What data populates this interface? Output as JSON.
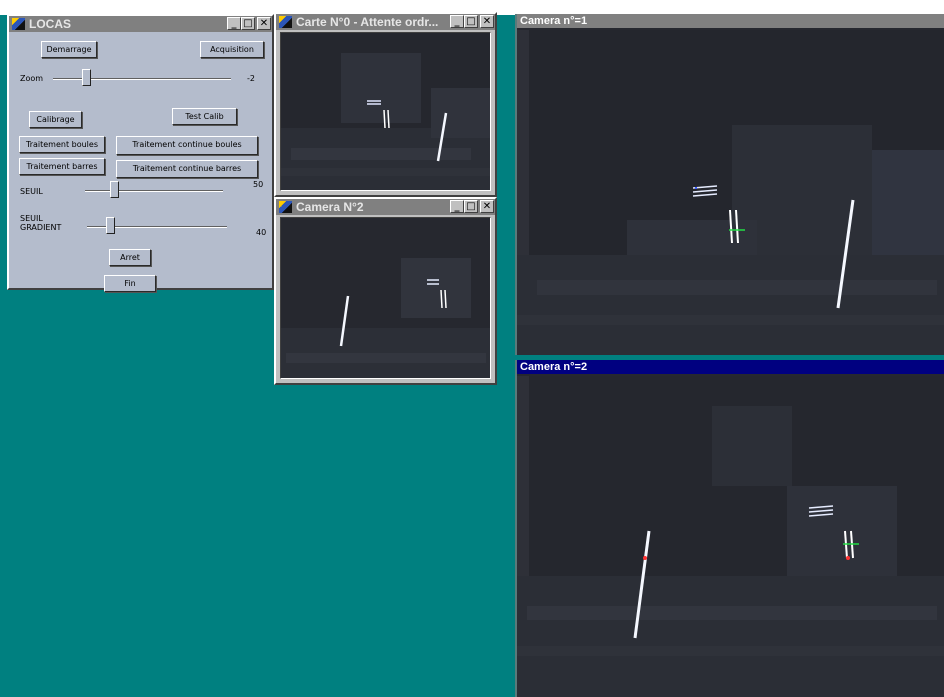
{
  "locas": {
    "title": "LOCAS",
    "buttons": {
      "demarrage": "Demarrage",
      "acquisition": "Acquisition",
      "calibrage": "Calibrage",
      "test_calib": "Test Calib",
      "traitement_boules": "Traitement boules",
      "traitement_continue_boules": "Traitement continue boules",
      "traitement_barres": "Traitement barres",
      "traitement_continue_barres": "Traitement continue barres",
      "arret": "Arret",
      "fin": "Fin"
    },
    "zoom": {
      "label": "Zoom",
      "value": "-2"
    },
    "seuil": {
      "label": "SEUIL",
      "value": "50"
    },
    "seuil_gradient": {
      "label_line1": "SEUIL",
      "label_line2": "GRADIENT",
      "value": "40"
    }
  },
  "carte_window": {
    "title": "Carte N°0 - Attente ordr..."
  },
  "camera2_window": {
    "title": "Camera N°2"
  },
  "camera_view_1": {
    "title": "Camera n°=1",
    "title_bg": "#808080"
  },
  "camera_view_2": {
    "title": "Camera n°=2",
    "title_bg": "#000080"
  },
  "controls": {
    "minimize": "_",
    "maximize": "□",
    "close": "✕"
  }
}
